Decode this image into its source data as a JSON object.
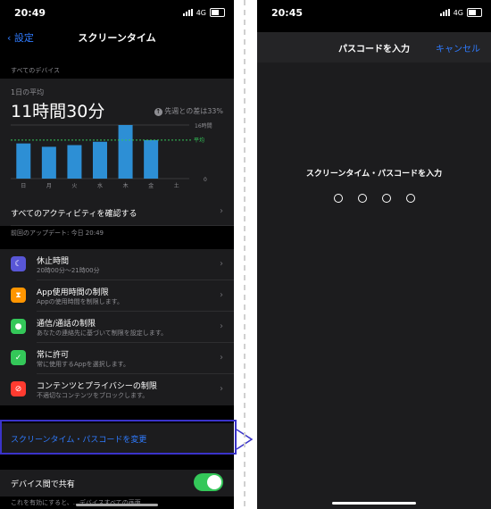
{
  "left": {
    "status": {
      "time": "20:49",
      "network": "4G"
    },
    "nav": {
      "back_label": "設定",
      "title": "スクリーンタイム"
    },
    "devices_label": "すべてのデバイス",
    "summary": {
      "avg_label": "1日の平均",
      "avg_value": "11時間30分",
      "comparison": "先週との差は33%",
      "axis_max": "16時間",
      "avg_line_label": "平均",
      "axis_zero": "0"
    },
    "chart_data": {
      "type": "bar",
      "categories": [
        "日",
        "月",
        "火",
        "水",
        "木",
        "金",
        "土"
      ],
      "values": [
        10.5,
        9.5,
        10,
        11,
        16,
        11.5,
        0
      ],
      "avg_value": 11.5,
      "ylim": [
        0,
        16
      ],
      "bar_color": "#2d8fd5",
      "avg_line_color": "#34c759"
    },
    "activity_link": "すべてのアクティビティを確認する",
    "last_update": "前回のアップデート: 今日 20:49",
    "menu": [
      {
        "title": "休止時間",
        "subtitle": "20時00分～21時00分",
        "icon": "moon-icon",
        "color": "#5856d6",
        "glyph": "☾"
      },
      {
        "title": "App使用時間の制限",
        "subtitle": "Appの使用時間を制限します。",
        "icon": "hourglass-icon",
        "color": "#ff9500",
        "glyph": "⧗"
      },
      {
        "title": "通信/通話の制限",
        "subtitle": "あなたの連絡先に基づいて制限を設定します。",
        "icon": "person-icon",
        "color": "#34c759",
        "glyph": "●"
      },
      {
        "title": "常に許可",
        "subtitle": "常に使用するAppを選択します。",
        "icon": "checkmark-icon",
        "color": "#34c759",
        "glyph": "✓"
      },
      {
        "title": "コンテンツとプライバシーの制限",
        "subtitle": "不適切なコンテンツをブロックします。",
        "icon": "no-entry-icon",
        "color": "#ff3b30",
        "glyph": "⊘"
      }
    ],
    "passcode_change": "スクリーンタイム・パスコードを変更",
    "share_label": "デバイス間で共有",
    "footer_text": "これを有効にすると、…デバイスすべての画面"
  },
  "right": {
    "status": {
      "time": "20:45",
      "network": "4G"
    },
    "nav": {
      "title": "パスコードを入力",
      "cancel_label": "キャンセル"
    },
    "prompt": "スクリーンタイム・パスコードを入力",
    "digit_count": 4
  }
}
